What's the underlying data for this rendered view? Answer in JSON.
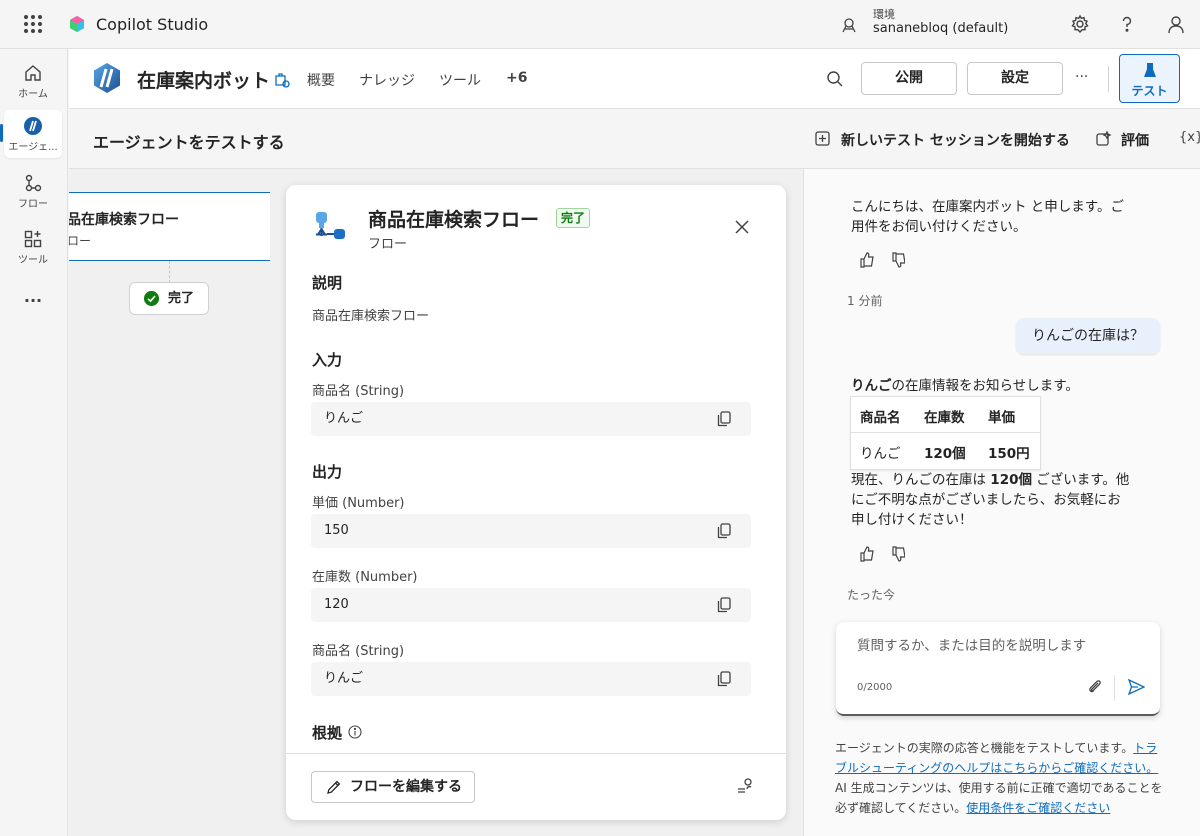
{
  "topbar": {
    "app_name": "Copilot Studio",
    "env_label": "環境",
    "env_value": "sananebloq (default)"
  },
  "rail": {
    "items": [
      {
        "label": "ホーム"
      },
      {
        "label": "エージェ..."
      },
      {
        "label": "フロー"
      },
      {
        "label": "ツール"
      }
    ],
    "more": "..."
  },
  "header": {
    "bot_title": "在庫案内ボット",
    "tabs": [
      "概要",
      "ナレッジ",
      "ツール",
      "+6"
    ],
    "publish": "公開",
    "settings": "設定",
    "more": "···",
    "test": "テスト"
  },
  "test_header": {
    "title": "エージェントをテストする",
    "new_session": "新しいテスト セッションを開始する",
    "evaluate": "評価",
    "variables": "{x}"
  },
  "canvas": {
    "node_title": "品在庫検索フロー",
    "node_sub": "ロー",
    "done": "完了"
  },
  "panel": {
    "title": "商品在庫検索フロー",
    "badge": "完了",
    "subtitle": "フロー",
    "description_h": "説明",
    "description": "商品在庫検索フロー",
    "input_h": "入力",
    "inputs": [
      {
        "label": "商品名 (String)",
        "value": "りんご"
      }
    ],
    "output_h": "出力",
    "outputs": [
      {
        "label": "単価 (Number)",
        "value": "150"
      },
      {
        "label": "在庫数 (Number)",
        "value": "120"
      },
      {
        "label": "商品名 (String)",
        "value": "りんご"
      }
    ],
    "basis_h": "根拠",
    "edit_flow": "フローを編集する"
  },
  "chat": {
    "greeting_line1": "こんにちは、在庫案内ボット と申します。ご",
    "greeting_line2": "用件をお伺い付けください。",
    "ts1": "1 分前",
    "user_msg": "りんごの在庫は？",
    "reply_bold": "りんご",
    "reply_rest": "の在庫情報をお知らせします。",
    "table": {
      "headers": [
        "商品名",
        "在庫数",
        "単価"
      ],
      "row": [
        "りんご",
        "120個",
        "150円"
      ]
    },
    "after_l1_pre": "現在、りんごの在庫は ",
    "after_l1_bold": "120個",
    "after_l1_post": " ございます。他",
    "after_l2": "にご不明な点がございましたら、お気軽にお",
    "after_l3": "申し付けください！",
    "ts2": "たった今",
    "input_placeholder": "質問するか、または目的を説明します",
    "counter": "0/2000",
    "disclaimer_1": "エージェントの実際の応答と機能をテストしています。",
    "disclaimer_link1": "トラブルシューティングのヘルプはこちらからご確認ください。",
    "disclaimer_2": " AI 生成コンテンツは、使用する前に正確で適切であることを必ず確認してください。",
    "disclaimer_link2": "使用条件をご確認ください"
  },
  "colors": {
    "accent": "#0f6cbd",
    "success": "#107c10",
    "user_bubble": "#e8f1fb"
  }
}
